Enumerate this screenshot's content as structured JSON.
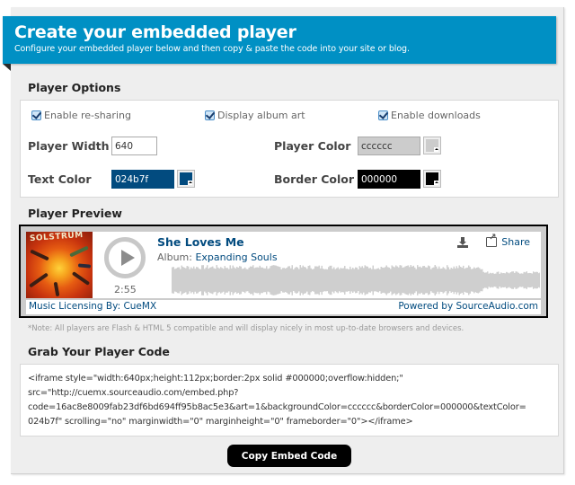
{
  "header": {
    "title": "Create your embedded player",
    "subtitle": "Configure your embedded player below and then copy & paste the code into your site or blog."
  },
  "options": {
    "title": "Player Options",
    "checkboxes": [
      {
        "label": "Enable re-sharing",
        "checked": true
      },
      {
        "label": "Display album art",
        "checked": true
      },
      {
        "label": "Enable downloads",
        "checked": true
      }
    ],
    "player_width": {
      "label": "Player Width",
      "value": "640"
    },
    "player_color": {
      "label": "Player Color",
      "value": "cccccc",
      "color": "#cccccc"
    },
    "text_color": {
      "label": "Text Color",
      "value": "024b7f",
      "color": "#024b7f"
    },
    "border_color": {
      "label": "Border Color",
      "value": "000000",
      "color": "#000000"
    }
  },
  "preview": {
    "title": "Player Preview",
    "album_art_title": "SOLSTRUM",
    "duration": "2:55",
    "song_title": "She Loves Me",
    "album_prefix": "Album: ",
    "album_name": "Expanding Souls",
    "share_label": "Share",
    "footer_left": "Music Licensing By: CueMX",
    "footer_right": "Powered by SourceAudio.com",
    "note": "*Note: All players are Flash & HTML 5 compatible and will display nicely in most up-to-date browsers and devices."
  },
  "code": {
    "title": "Grab Your Player Code",
    "line1": "<iframe style=\"width:640px;height:112px;border:2px solid #000000;overflow:hidden;\"",
    "line2": "src=\"http://cuemx.sourceaudio.com/embed.php?",
    "line3": "code=16ac8e8009fab23df6bd694ff95b8ac5e3&art=1&backgroundColor=cccccc&borderColor=000000&textColor=",
    "line4": "024b7f\" scrolling=\"no\" marginwidth=\"0\" marginheight=\"0\" frameborder=\"0\"></iframe>",
    "copy_button": "Copy Embed Code"
  },
  "colors": {
    "header_bg": "#0090c4",
    "link": "#024b7f"
  }
}
